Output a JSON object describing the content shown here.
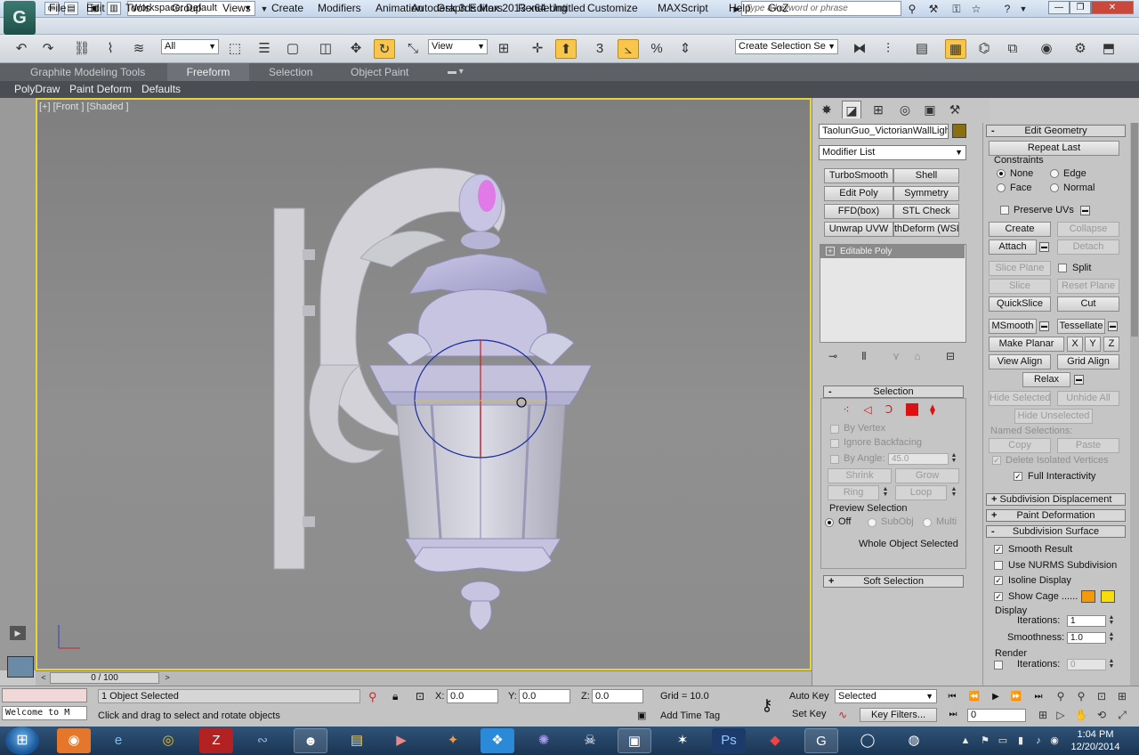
{
  "titlebar": {
    "logo": "G",
    "workspace": "Workspace: Default",
    "app_title": "Autodesk 3ds Max  2013 x64     Untitled",
    "search_placeholder": "Type a keyword or phrase"
  },
  "menus": [
    "File",
    "Edit",
    "Tools",
    "Group",
    "Views",
    "Create",
    "Modifiers",
    "Animation",
    "Graph Editors",
    "Rendering",
    "Customize",
    "MAXScript",
    "Help",
    "GoZ"
  ],
  "toolbar": {
    "filter": "All",
    "ref_coord": "View",
    "selection_set": "Create Selection Se"
  },
  "ribbon": {
    "tabs": [
      "Graphite Modeling Tools",
      "Freeform",
      "Selection",
      "Object Paint"
    ],
    "active_tab": "Freeform",
    "subtabs": [
      "PolyDraw",
      "Paint Deform",
      "Defaults"
    ]
  },
  "viewport": {
    "label": "[+] [Front ] [Shaded ]"
  },
  "command_panel": {
    "object_name": "TaolunGuo_VictorianWallLight",
    "object_color": "#8a6f10",
    "modifier_list": "Modifier List",
    "modifier_buttons": [
      "TurboSmooth",
      "Shell",
      "Edit Poly",
      "Symmetry",
      "FFD(box)",
      "STL Check",
      "Unwrap UVW",
      "thDeform (WSI"
    ],
    "stack_item": "Editable Poly",
    "selection": {
      "title": "Selection",
      "by_vertex": "By Vertex",
      "ignore_backfacing": "Ignore Backfacing",
      "by_angle": "By Angle:",
      "angle_value": "45.0",
      "shrink": "Shrink",
      "grow": "Grow",
      "ring": "Ring",
      "loop": "Loop",
      "preview_selection": "Preview Selection",
      "preview_off": "Off",
      "preview_subobj": "SubObj",
      "preview_multi": "Multi",
      "status": "Whole Object Selected"
    },
    "soft_selection": "Soft Selection"
  },
  "edit_geometry": {
    "title": "Edit Geometry",
    "repeat_last": "Repeat Last",
    "constraints": "Constraints",
    "c_none": "None",
    "c_edge": "Edge",
    "c_face": "Face",
    "c_normal": "Normal",
    "preserve_uvs": "Preserve UVs",
    "create": "Create",
    "collapse": "Collapse",
    "attach": "Attach",
    "detach": "Detach",
    "slice_plane": "Slice Plane",
    "split": "Split",
    "slice": "Slice",
    "reset_plane": "Reset Plane",
    "quickslice": "QuickSlice",
    "cut": "Cut",
    "msmooth": "MSmooth",
    "tessellate": "Tessellate",
    "make_planar": "Make Planar",
    "x": "X",
    "y": "Y",
    "z": "Z",
    "view_align": "View Align",
    "grid_align": "Grid Align",
    "relax": "Relax",
    "hide_selected": "Hide Selected",
    "unhide_all": "Unhide All",
    "hide_unselected": "Hide Unselected",
    "named_selections": "Named Selections:",
    "copy": "Copy",
    "paste": "Paste",
    "delete_isolated": "Delete Isolated Vertices",
    "full_interactivity": "Full Interactivity"
  },
  "subdivision": {
    "displacement": "Subdivision Displacement",
    "paint_deformation": "Paint Deformation",
    "surface": "Subdivision Surface",
    "smooth_result": "Smooth Result",
    "use_nurms": "Use NURMS Subdivision",
    "isoline_display": "Isoline Display",
    "show_cage": "Show Cage ......",
    "cage_color_1": "#f39a0c",
    "cage_color_2": "#f4dd0a",
    "display": "Display",
    "iterations_label": "Iterations:",
    "iterations": "1",
    "smoothness_label": "Smoothness:",
    "smoothness": "1.0",
    "render": "Render",
    "render_iterations": "0"
  },
  "timeline": {
    "slider": "0 / 100"
  },
  "status": {
    "maxscript_line": "Welcome to M",
    "objects_selected": "1 Object Selected",
    "prompt": "Click and drag to select and rotate objects",
    "x_label": "X:",
    "x": "0.0",
    "y_label": "Y:",
    "y": "0.0",
    "z_label": "Z:",
    "z": "0.0",
    "grid": "Grid = 10.0",
    "add_time_tag": "Add Time Tag",
    "auto_key": "Auto Key",
    "set_key": "Set Key",
    "key_mode": "Selected",
    "key_filters": "Key Filters...",
    "frame": "0"
  },
  "taskbar": {
    "time": "1:04 PM",
    "date": "12/20/2014"
  }
}
